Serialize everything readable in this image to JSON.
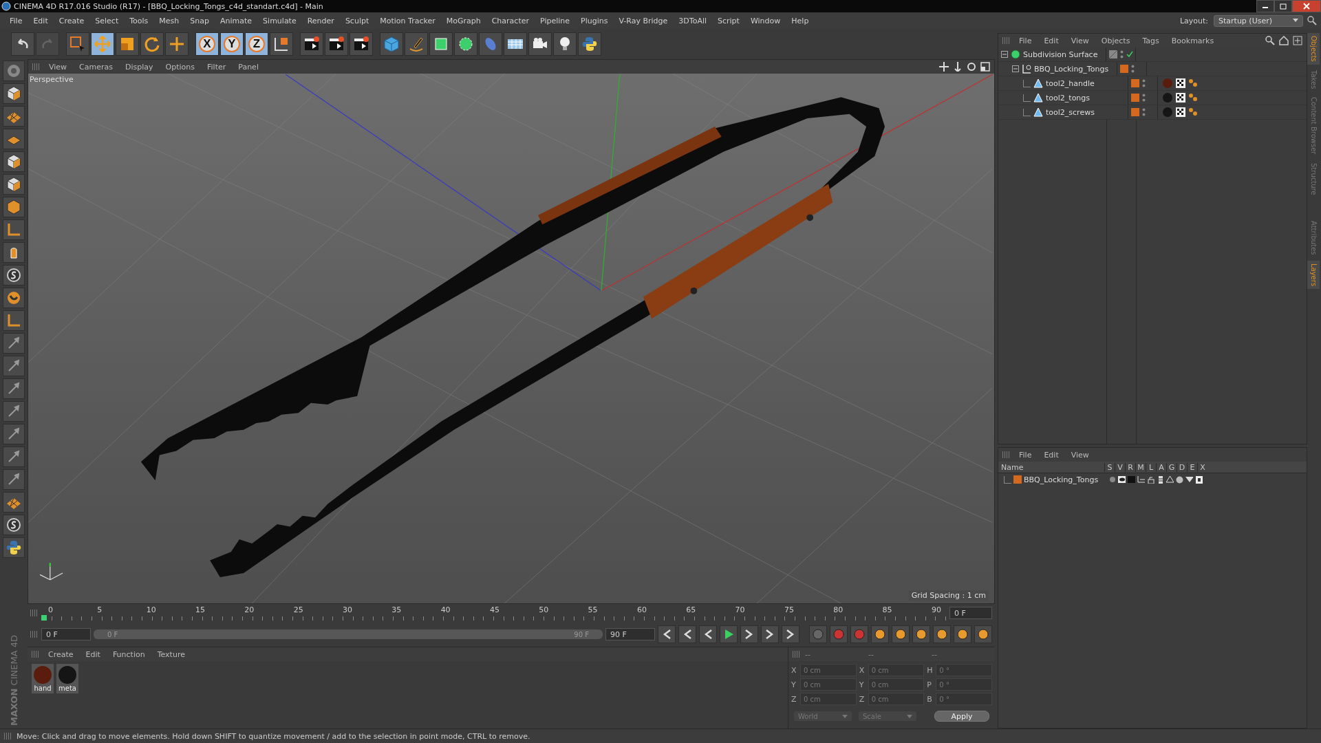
{
  "window": {
    "title": "CINEMA 4D R17.016 Studio (R17) - [BBQ_Locking_Tongs_c4d_standart.c4d] - Main"
  },
  "menu": [
    "File",
    "Edit",
    "Create",
    "Select",
    "Tools",
    "Mesh",
    "Snap",
    "Animate",
    "Simulate",
    "Render",
    "Sculpt",
    "Motion Tracker",
    "MoGraph",
    "Character",
    "Pipeline",
    "Plugins",
    "V-Ray Bridge",
    "3DToAll",
    "Script",
    "Window",
    "Help"
  ],
  "layout": {
    "label": "Layout:",
    "value": "Startup (User)"
  },
  "tools": [
    {
      "kind": "live-select",
      "selected": false
    },
    {
      "kind": "move",
      "selected": true
    },
    {
      "kind": "scale",
      "selected": false
    },
    {
      "kind": "rotate",
      "selected": false
    },
    {
      "kind": "recent",
      "selected": false
    }
  ],
  "axis_locks": [
    {
      "label": "X",
      "selected": true
    },
    {
      "label": "Y",
      "selected": true
    },
    {
      "label": "Z",
      "selected": true
    }
  ],
  "viewport": {
    "menu": [
      "View",
      "Cameras",
      "Display",
      "Options",
      "Filter",
      "Panel"
    ],
    "camera": "Perspective",
    "grid_spacing": "Grid Spacing : 1 cm"
  },
  "timeline": {
    "ruler": [
      "0",
      "5",
      "10",
      "15",
      "20",
      "25",
      "30",
      "35",
      "40",
      "45",
      "50",
      "55",
      "60",
      "65",
      "70",
      "75",
      "80",
      "85",
      "90"
    ],
    "current_frame": "0 F",
    "start_frame": "0 F",
    "range": {
      "start": "0 F",
      "end": "90 F",
      "level": 1
    },
    "end_frame": "90 F"
  },
  "materials": {
    "menu": [
      "Create",
      "Edit",
      "Function",
      "Texture"
    ],
    "items": [
      {
        "name": "hand",
        "color": "#5a1c0c"
      },
      {
        "name": "meta",
        "color": "#151515"
      }
    ]
  },
  "coordinates": {
    "headers": [
      "--",
      "--",
      "--"
    ],
    "columns": [
      [
        {
          "axis": "X",
          "value": "0 cm"
        },
        {
          "axis": "Y",
          "value": "0 cm"
        },
        {
          "axis": "Z",
          "value": "0 cm"
        }
      ],
      [
        {
          "axis": "X",
          "value": "0 cm"
        },
        {
          "axis": "Y",
          "value": "0 cm"
        },
        {
          "axis": "Z",
          "value": "0 cm"
        }
      ],
      [
        {
          "axis": "H",
          "value": "0 °"
        },
        {
          "axis": "P",
          "value": "0 °"
        },
        {
          "axis": "B",
          "value": "0 °"
        }
      ]
    ],
    "dropdowns": [
      "World",
      "Scale"
    ],
    "apply": "Apply"
  },
  "logo": {
    "brand": "MAXON",
    "product": "CINEMA 4D"
  },
  "status_bar": "Move: Click and drag to move elements. Hold down SHIFT to quantize movement / add to the selection in point mode, CTRL to remove.",
  "object_manager": {
    "menu": [
      "File",
      "Edit",
      "View",
      "Objects",
      "Tags",
      "Bookmarks"
    ],
    "objects": [
      {
        "name": "Subdivision Surface",
        "kind": "subdivision",
        "expanded": true,
        "enabled": true,
        "children": [
          {
            "name": "BBQ_Locking_Tongs",
            "kind": "null",
            "expanded": true,
            "color": "#d2691e",
            "children": [
              {
                "name": "tool2_handle",
                "kind": "polygon",
                "color": "#d2691e",
                "tags": [
                  {
                    "kind": "material",
                    "color": "#5a1c0c"
                  },
                  {
                    "kind": "uvw"
                  },
                  {
                    "kind": "phong"
                  }
                ]
              },
              {
                "name": "tool2_tongs",
                "kind": "polygon",
                "color": "#d2691e",
                "tags": [
                  {
                    "kind": "material",
                    "color": "#151515"
                  },
                  {
                    "kind": "uvw"
                  },
                  {
                    "kind": "phong"
                  }
                ]
              },
              {
                "name": "tool2_screws",
                "kind": "polygon",
                "color": "#d2691e",
                "tags": [
                  {
                    "kind": "material",
                    "color": "#151515"
                  },
                  {
                    "kind": "uvw"
                  },
                  {
                    "kind": "phong"
                  }
                ]
              }
            ]
          }
        ]
      }
    ]
  },
  "layer_manager": {
    "menu": [
      "File",
      "Edit",
      "View"
    ],
    "columns": [
      "Name",
      "S",
      "V",
      "R",
      "M",
      "L",
      "A",
      "G",
      "D",
      "E",
      "X"
    ],
    "layers": [
      {
        "name": "BBQ_Locking_Tongs",
        "color": "#d2691e"
      }
    ]
  },
  "side_tabs_top": [
    {
      "label": "Objects",
      "selected": true
    },
    {
      "label": "Takes",
      "selected": false
    },
    {
      "label": "Content Browser",
      "selected": false
    },
    {
      "label": "Structure",
      "selected": false
    }
  ],
  "side_tabs_bottom": [
    {
      "label": "Attributes",
      "selected": false
    },
    {
      "label": "Layers",
      "selected": true
    }
  ]
}
